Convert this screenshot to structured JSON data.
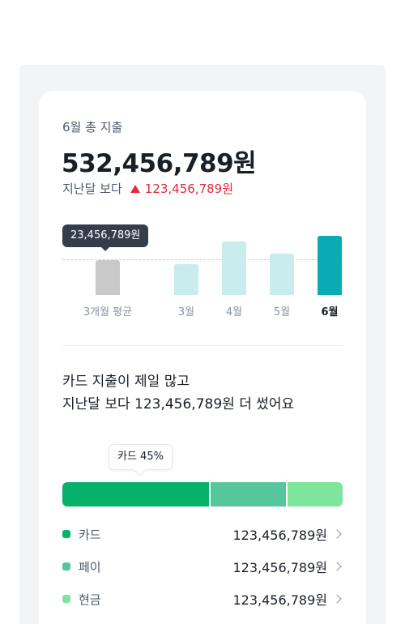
{
  "header": {
    "title": "6월 총 지출",
    "total": "532,456,789원",
    "compare_label": "지난달 보다",
    "compare_diff": "123,456,789원"
  },
  "chart_data": {
    "type": "bar",
    "categories": [
      "3개월 평균",
      "3월",
      "4월",
      "5월",
      "6월"
    ],
    "values": [
      13,
      11.5,
      20,
      15.5,
      22
    ],
    "average_tooltip": "23,456,789원",
    "active_category": "6월",
    "colors": {
      "average": "#c9c9c9",
      "past": "#c9ecef",
      "active": "#0aacb3"
    }
  },
  "summary": {
    "line1": "카드 지출이 제일 많고",
    "line2": "지난달 보다 123,456,789원 더 썼어요"
  },
  "breakdown": {
    "badge": "카드 45%",
    "shares": [
      53,
      27,
      20
    ],
    "items": [
      {
        "name": "카드",
        "amount": "123,456,789원",
        "color": "#06b16c"
      },
      {
        "name": "페이",
        "amount": "123,456,789원",
        "color": "#56c69d"
      },
      {
        "name": "현금",
        "amount": "123,456,789원",
        "color": "#7ee59c"
      }
    ]
  }
}
